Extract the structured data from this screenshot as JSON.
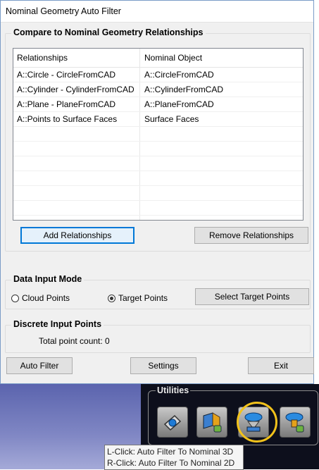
{
  "window": {
    "title": "Nominal Geometry Auto Filter"
  },
  "compare_group": {
    "title": "Compare to Nominal Geometry Relationships",
    "columns": [
      "Relationships",
      "Nominal Object"
    ],
    "rows": [
      {
        "relationship": "A::Circle - CircleFromCAD",
        "nominal": "A::CircleFromCAD"
      },
      {
        "relationship": "A::Cylinder - CylinderFromCAD",
        "nominal": "A::CylinderFromCAD"
      },
      {
        "relationship": "A::Plane - PlaneFromCAD",
        "nominal": "A::PlaneFromCAD"
      },
      {
        "relationship": "A::Points to Surface Faces",
        "nominal": "Surface Faces"
      }
    ],
    "add_label": "Add Relationships",
    "remove_label": "Remove Relationships"
  },
  "input_mode": {
    "title": "Data Input Mode",
    "cloud_label": "Cloud Points",
    "target_label": "Target Points",
    "selected": "target",
    "select_button": "Select Target Points"
  },
  "discrete": {
    "title": "Discrete Input Points",
    "count_text": "Total point count: 0"
  },
  "footer": {
    "auto_filter": "Auto Filter",
    "settings": "Settings",
    "exit": "Exit"
  },
  "utilities": {
    "title": "Utilities",
    "tools": [
      "measure-icon",
      "nominal-filter-icon",
      "auto-filter-nominal-icon",
      "cloud-import-icon"
    ]
  },
  "tooltip": {
    "line1": "L-Click: Auto Filter To Nominal 3D",
    "line2": "R-Click: Auto Filter To Nominal 2D"
  },
  "colors": {
    "accent": "#0078d7",
    "highlight": "#f2c21b",
    "dialog_bg": "#f0f0f0"
  }
}
